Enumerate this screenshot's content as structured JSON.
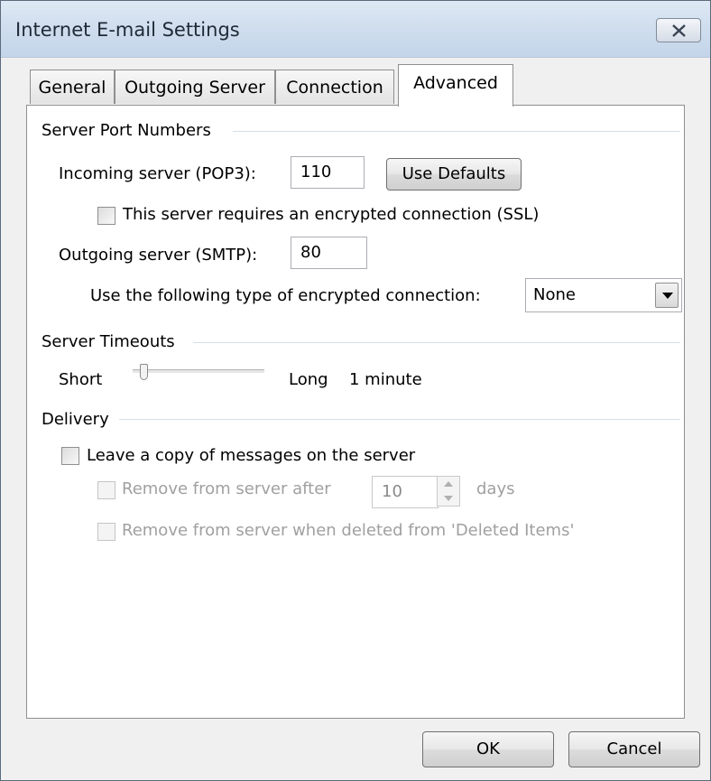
{
  "window": {
    "title": "Internet E-mail Settings"
  },
  "tabs": [
    {
      "label": "General"
    },
    {
      "label": "Outgoing Server"
    },
    {
      "label": "Connection"
    },
    {
      "label": "Advanced",
      "active": true
    }
  ],
  "server_ports": {
    "group_label": "Server Port Numbers",
    "incoming_label": "Incoming server (POP3):",
    "incoming_value": "110",
    "use_defaults_label": "Use Defaults",
    "ssl_label": "This server requires an encrypted connection (SSL)",
    "ssl_checked": false,
    "outgoing_label": "Outgoing server (SMTP):",
    "outgoing_value": "80",
    "encryption_label": "Use the following type of encrypted connection:",
    "encryption_value": "None"
  },
  "timeouts": {
    "group_label": "Server Timeouts",
    "short_label": "Short",
    "long_label": "Long",
    "value_text": "1 minute",
    "slider_level": 0.0
  },
  "delivery": {
    "group_label": "Delivery",
    "leave_copy_label": "Leave a copy of messages on the server",
    "leave_copy_checked": false,
    "remove_after_label": "Remove from server after",
    "remove_after_days": "10",
    "days_label": "days",
    "remove_deleted_label": "Remove from server when deleted from 'Deleted Items'"
  },
  "footer": {
    "ok_label": "OK",
    "cancel_label": "Cancel"
  }
}
